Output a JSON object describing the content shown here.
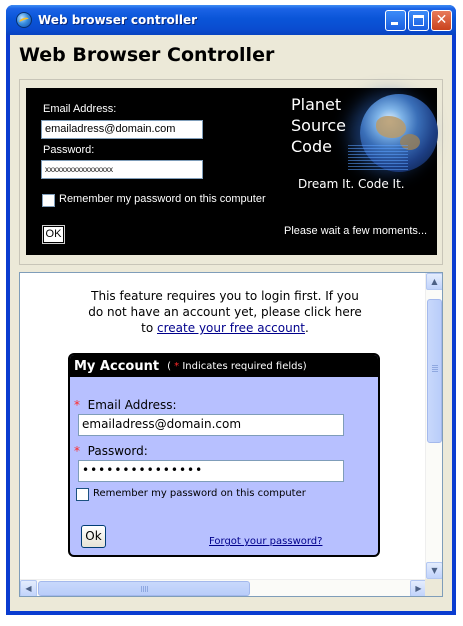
{
  "window": {
    "title": "Web browser controller",
    "controls": {
      "minimize": "minimize",
      "maximize": "maximize",
      "close": "close"
    }
  },
  "heading": "Web Browser Controller",
  "native_form": {
    "email_label": "Email Address:",
    "email_value": "emailadress@domain.com",
    "password_label": "Password:",
    "password_value": "xxxxxxxxxxxxxxxxx",
    "remember_label": "Remember my password on this computer",
    "ok_label": "OK",
    "status": "Please wait a few moments...",
    "logo": {
      "line1": "Planet",
      "line2": "Source",
      "line3": "Code",
      "tagline": "Dream It.  Code It."
    }
  },
  "browser": {
    "intro_line1": "This feature requires you to login first.  If you",
    "intro_line2": "do not have an account yet, please click here",
    "intro_to": "to ",
    "intro_link": "create your free account",
    "intro_end": ".",
    "account": {
      "title": "My Account",
      "note_open": "( ",
      "note_star": "*",
      "note_text": " Indicates required fields)",
      "email_star": "*",
      "email_label": "Email Address:",
      "email_value": "emailadress@domain.com",
      "password_star": "*",
      "password_label": "Password:",
      "password_value": "•••••••••••••••",
      "remember_label": "Remember my password on this computer",
      "ok_label": "Ok",
      "forgot_link": "Forgot your password?"
    }
  },
  "colors": {
    "title_bar": "#0a55d8",
    "account_bg": "#b7c0ff",
    "link": "#00008b",
    "required_star": "#ff2a2a"
  }
}
